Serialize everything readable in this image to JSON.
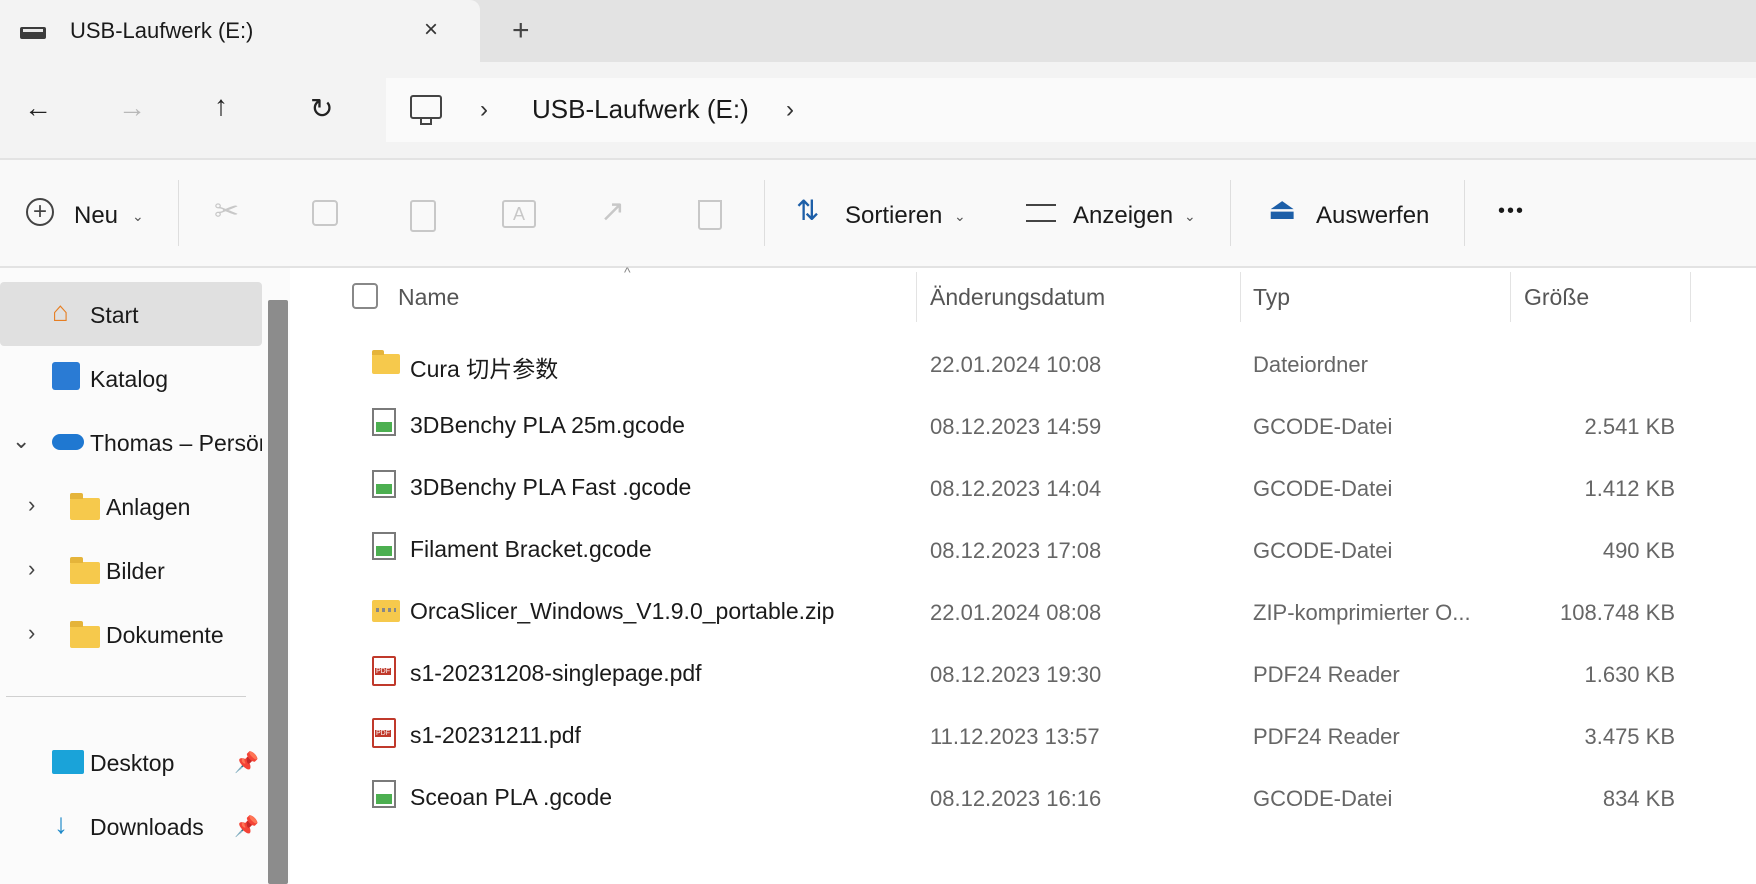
{
  "tab": {
    "title": "USB-Laufwerk (E:)",
    "close_icon": "×",
    "new_tab_icon": "+"
  },
  "nav": {
    "back": "←",
    "forward": "→",
    "up": "↑",
    "refresh": "↻"
  },
  "breadcrumb": {
    "location": "USB-Laufwerk (E:)",
    "separator": "›"
  },
  "toolbar": {
    "new_label": "Neu",
    "sort_label": "Sortieren",
    "view_label": "Anzeigen",
    "eject_label": "Auswerfen",
    "more_label": "•••"
  },
  "sidebar": {
    "items": [
      {
        "label": "Start"
      },
      {
        "label": "Katalog"
      },
      {
        "label": "Thomas – Persön"
      },
      {
        "label": "Anlagen"
      },
      {
        "label": "Bilder"
      },
      {
        "label": "Dokumente"
      },
      {
        "label": "Desktop"
      },
      {
        "label": "Downloads"
      }
    ]
  },
  "columns": {
    "name": "Name",
    "date": "Änderungsdatum",
    "type": "Typ",
    "size": "Größe"
  },
  "files": [
    {
      "name": "Cura 切片参数",
      "date": "22.01.2024 10:08",
      "type": "Dateiordner",
      "size": "",
      "icon": "folder-icon"
    },
    {
      "name": "3DBenchy PLA 25m.gcode",
      "date": "08.12.2023 14:59",
      "type": "GCODE-Datei",
      "size": "2.541 KB",
      "icon": "gcode-file-icon"
    },
    {
      "name": "3DBenchy PLA Fast .gcode",
      "date": "08.12.2023 14:04",
      "type": "GCODE-Datei",
      "size": "1.412 KB",
      "icon": "gcode-file-icon"
    },
    {
      "name": "Filament Bracket.gcode",
      "date": "08.12.2023 17:08",
      "type": "GCODE-Datei",
      "size": "490 KB",
      "icon": "gcode-file-icon"
    },
    {
      "name": "OrcaSlicer_Windows_V1.9.0_portable.zip",
      "date": "22.01.2024 08:08",
      "type": "ZIP-komprimierter O...",
      "size": "108.748 KB",
      "icon": "zip-file-icon"
    },
    {
      "name": "s1-20231208-singlepage.pdf",
      "date": "08.12.2023 19:30",
      "type": "PDF24 Reader",
      "size": "1.630 KB",
      "icon": "pdf-file-icon"
    },
    {
      "name": "s1-20231211.pdf",
      "date": "11.12.2023 13:57",
      "type": "PDF24 Reader",
      "size": "3.475 KB",
      "icon": "pdf-file-icon"
    },
    {
      "name": "Sceoan PLA .gcode",
      "date": "08.12.2023 16:16",
      "type": "GCODE-Datei",
      "size": "834 KB",
      "icon": "gcode-file-icon"
    }
  ]
}
